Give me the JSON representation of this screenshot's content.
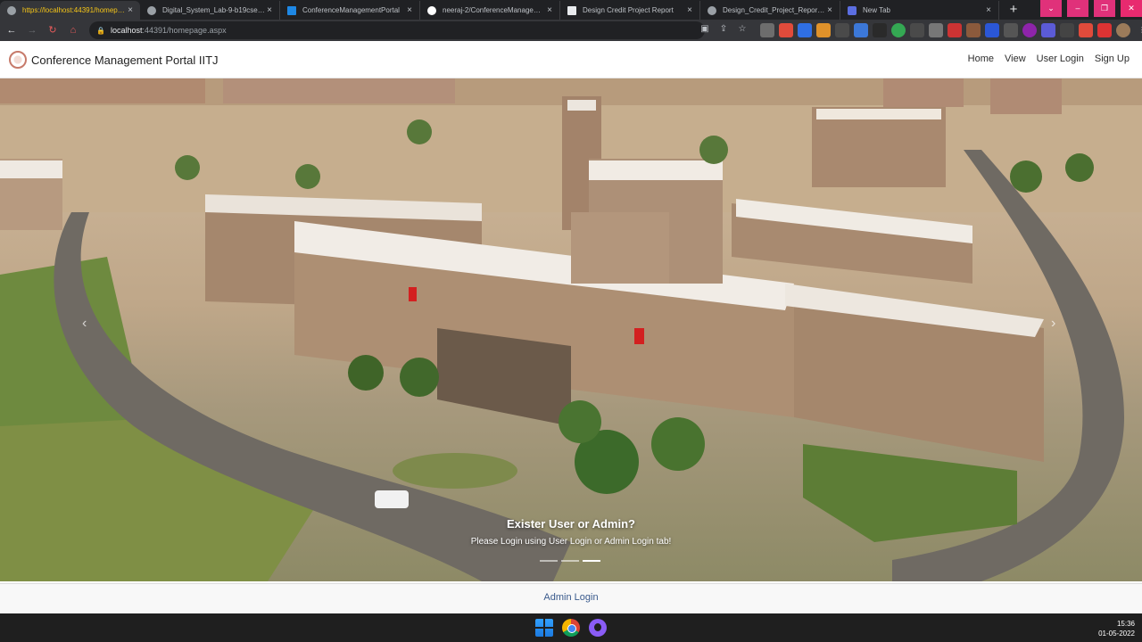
{
  "browser": {
    "tabs": [
      {
        "title": "https://localhost:44391/homepage.aspx",
        "active": true,
        "favicon_color": "#9aa0a6"
      },
      {
        "title": "Digital_System_Lab-9-b19cse11...",
        "active": false,
        "favicon_color": "#9aa0a6"
      },
      {
        "title": "ConferenceManagementPortal",
        "active": false,
        "favicon_color": "#1e88e5"
      },
      {
        "title": "neeraj-2/ConferenceManagem...",
        "active": false,
        "favicon_color": "#ffffff"
      },
      {
        "title": "Design Credit Project Report",
        "active": false,
        "favicon_color": "#e8eaed"
      },
      {
        "title": "Design_Credit_Project_Report.p...",
        "active": false,
        "favicon_color": "#9aa0a6"
      },
      {
        "title": "New Tab",
        "active": false,
        "favicon_color": "#5b6ee1"
      }
    ],
    "new_tab": "+",
    "address": {
      "host": "localhost",
      "path": ":44391/homepage.aspx"
    }
  },
  "site": {
    "brand": "Conference Management Portal IITJ",
    "nav": {
      "home": "Home",
      "view": "View",
      "user_login": "User Login",
      "sign_up": "Sign Up"
    },
    "carousel": {
      "caption_title": "Exister User or Admin?",
      "caption_text": "Please Login using User Login or Admin Login tab!",
      "slide_count": 3,
      "active_slide": 3
    },
    "footer_link": "Admin Login"
  },
  "taskbar": {
    "time": "15:36",
    "date": "01-05-2022"
  }
}
